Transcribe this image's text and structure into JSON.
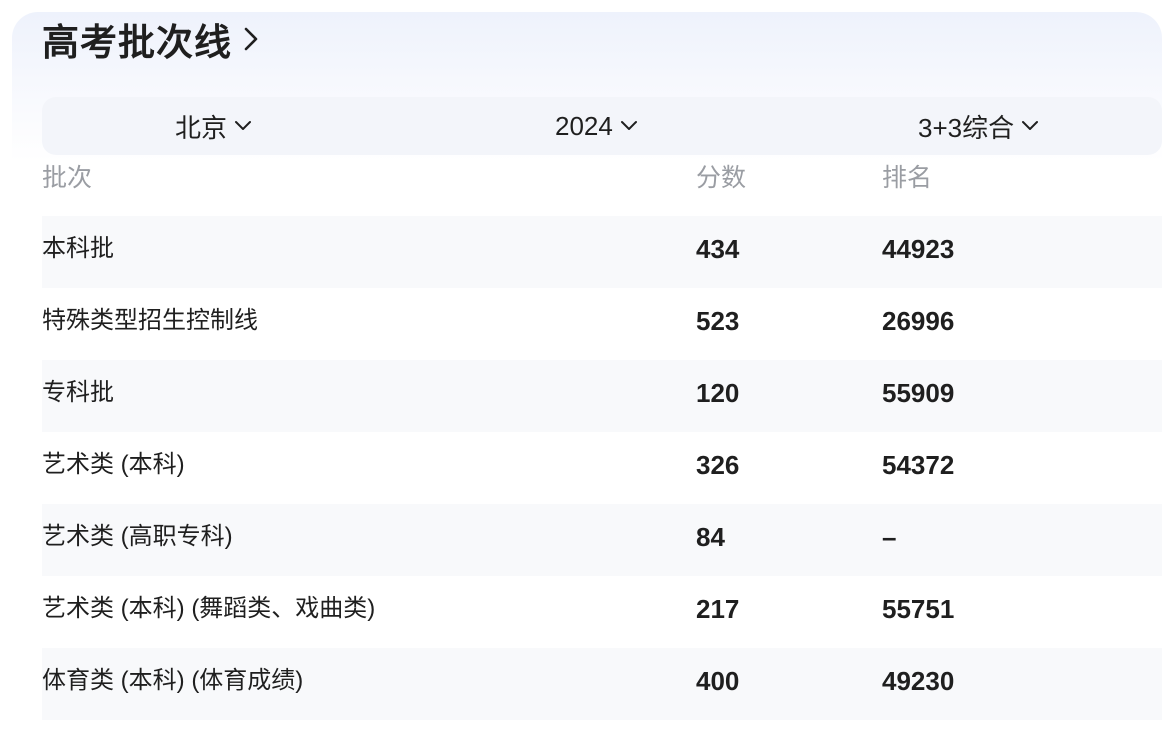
{
  "header": {
    "title": "高考批次线",
    "chevron_icon": "chevron-right-icon"
  },
  "filters": {
    "province": "北京",
    "year": "2024",
    "subject": "3+3综合",
    "chevron_icon": "chevron-down-icon"
  },
  "table": {
    "columns": [
      "批次",
      "分数",
      "排名"
    ],
    "rows": [
      {
        "name": "本科批",
        "score": "434",
        "rank": "44923"
      },
      {
        "name": "特殊类型招生控制线",
        "score": "523",
        "rank": "26996"
      },
      {
        "name": "专科批",
        "score": "120",
        "rank": "55909"
      },
      {
        "name": "艺术类 (本科)",
        "score": "326",
        "rank": "54372"
      },
      {
        "name": "艺术类 (高职专科)",
        "score": "84",
        "rank": "–"
      },
      {
        "name": "艺术类 (本科) (舞蹈类、戏曲类)",
        "score": "217",
        "rank": "55751"
      },
      {
        "name": "体育类 (本科) (体育成绩)",
        "score": "400",
        "rank": "49230"
      }
    ]
  },
  "colors": {
    "text": "#1f1f1f",
    "muted": "#9a9da3",
    "filter_bg": "#f3f5fa",
    "row_shade": "#f8f9fb"
  }
}
